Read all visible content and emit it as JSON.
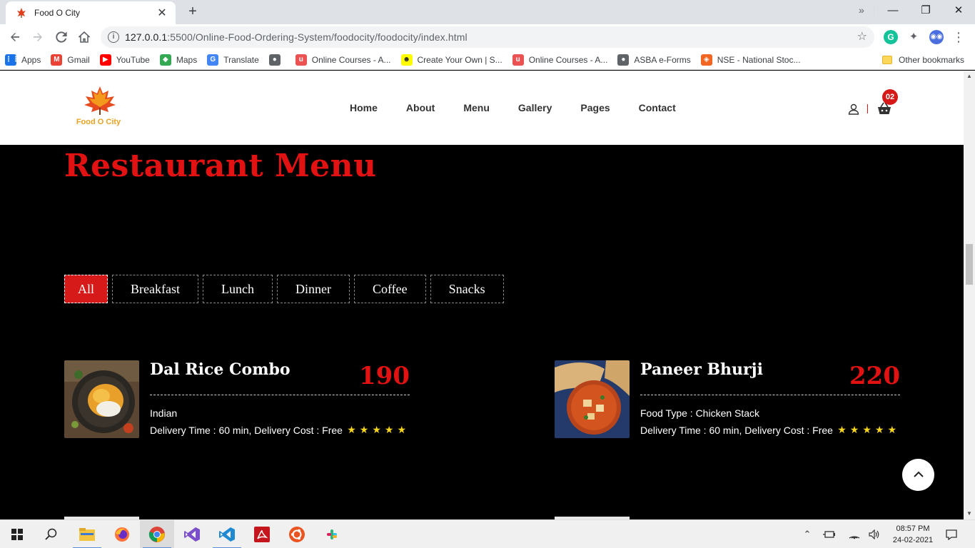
{
  "browser": {
    "tab_title": "Food O City",
    "tab_close": "✕",
    "new_tab": "+",
    "url_host": "127.0.0.1",
    "url_rest": ":5500/Online-Food-Ordering-System/foodocity/foodocity/index.html",
    "window_controls": {
      "minimize": "—",
      "maximize": "❐",
      "close": "✕"
    }
  },
  "bookmarks": {
    "items": [
      {
        "label": "Apps",
        "icon": "apps-grid-icon",
        "color": "#1a73e8"
      },
      {
        "label": "Gmail",
        "icon": "gmail-icon",
        "color": "#ea4335"
      },
      {
        "label": "YouTube",
        "icon": "youtube-icon",
        "color": "#ff0000"
      },
      {
        "label": "Maps",
        "icon": "maps-icon",
        "color": "#34a853"
      },
      {
        "label": "Translate",
        "icon": "translate-icon",
        "color": "#4285f4"
      },
      {
        "label": "",
        "icon": "globe-icon",
        "color": "#5f6368"
      },
      {
        "label": "Online Courses - A...",
        "icon": "udemy-icon",
        "color": "#ec5252"
      },
      {
        "label": "Create Your Own | S...",
        "icon": "snapchat-icon",
        "color": "#fffc00"
      },
      {
        "label": "Online Courses - A...",
        "icon": "udemy-icon",
        "color": "#ec5252"
      },
      {
        "label": "ASBA e-Forms",
        "icon": "globe-icon",
        "color": "#5f6368"
      },
      {
        "label": "NSE - National Stoc...",
        "icon": "nse-icon",
        "color": "#f26522"
      }
    ],
    "more": "»",
    "other": "Other bookmarks"
  },
  "site": {
    "logo_text": "Food O City",
    "nav": [
      "Home",
      "About",
      "Menu",
      "Gallery",
      "Pages",
      "Contact"
    ],
    "cart_count": "02",
    "accent": "#d61a1a"
  },
  "menu": {
    "title": "Restaurant Menu",
    "filters": [
      "All",
      "Breakfast",
      "Lunch",
      "Dinner",
      "Coffee",
      "Snacks"
    ],
    "active_filter": "All",
    "items": [
      {
        "name": "Dal Rice Combo",
        "price": "190",
        "type": "Indian",
        "delivery": "Delivery Time : 60 min, Delivery Cost : Free",
        "rating": 5
      },
      {
        "name": "Paneer Bhurji",
        "price": "220",
        "type": "Food Type : Chicken Stack",
        "delivery": "Delivery Time : 60 min, Delivery Cost : Free",
        "rating": 5
      }
    ],
    "stars": "★★★★★"
  },
  "taskbar": {
    "time": "08:57 PM",
    "date": "24-02-2021"
  }
}
